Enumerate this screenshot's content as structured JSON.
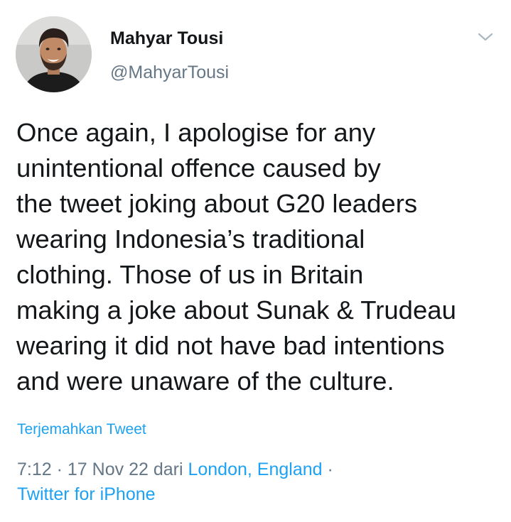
{
  "tweet": {
    "author": {
      "display_name": "Mahyar Tousi",
      "handle": "@MahyarTousi",
      "avatar_icon": "profile-photo"
    },
    "menu_icon": "chevron-down-icon",
    "text_lines": [
      "Once again, I apologise for any",
      "unintentional offence caused by",
      "the tweet joking about G20 leaders",
      "wearing Indonesia’s traditional",
      "clothing. Those of us in Britain",
      "making a joke about Sunak & Trudeau",
      "wearing it did not have bad intentions",
      "and were unaware of the culture."
    ],
    "translate_label": "Terjemahkan Tweet",
    "meta": {
      "time": "7:12",
      "separator": "·",
      "date": "17 Nov 22",
      "from_word": "dari",
      "location": "London, England",
      "source": "Twitter for iPhone"
    }
  },
  "colors": {
    "text": "#14171a",
    "secondary": "#657786",
    "link": "#1da1f2"
  }
}
